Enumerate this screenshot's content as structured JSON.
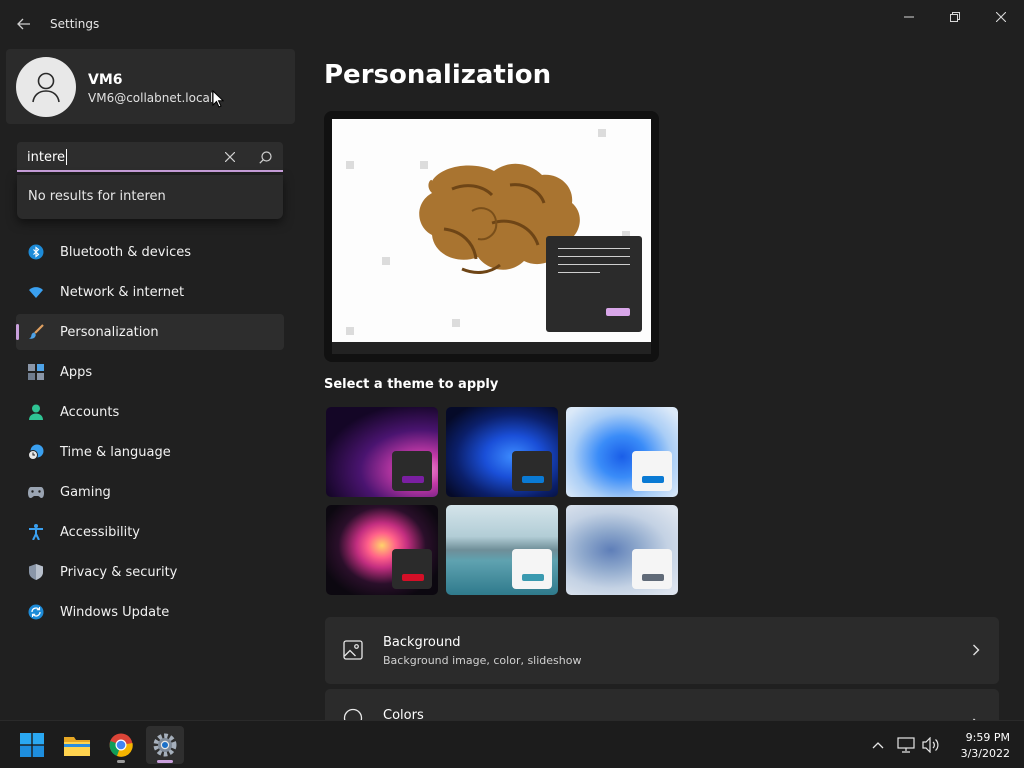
{
  "window": {
    "title": "Settings"
  },
  "profile": {
    "name": "VM6",
    "email": "VM6@collabnet.local"
  },
  "search": {
    "value": "intere",
    "no_results_text": "No results for interen"
  },
  "nav": {
    "items": [
      {
        "label": "Bluetooth & devices",
        "icon": "bluetooth-icon"
      },
      {
        "label": "Network & internet",
        "icon": "wifi-icon"
      },
      {
        "label": "Personalization",
        "icon": "brush-icon",
        "active": true
      },
      {
        "label": "Apps",
        "icon": "apps-icon"
      },
      {
        "label": "Accounts",
        "icon": "person-icon"
      },
      {
        "label": "Time & language",
        "icon": "globe-clock-icon"
      },
      {
        "label": "Gaming",
        "icon": "gamepad-icon"
      },
      {
        "label": "Accessibility",
        "icon": "accessibility-icon"
      },
      {
        "label": "Privacy & security",
        "icon": "shield-icon"
      },
      {
        "label": "Windows Update",
        "icon": "update-icon"
      }
    ]
  },
  "main": {
    "title": "Personalization",
    "themes_label": "Select a theme to apply",
    "themes": [
      {
        "name": "theme-glow",
        "accent": "#7a1fa2"
      },
      {
        "name": "theme-windows-dark",
        "accent": "#0a7ad4"
      },
      {
        "name": "theme-windows-light",
        "accent": "#0a7ad4"
      },
      {
        "name": "theme-captured-motion",
        "accent": "#d40f27"
      },
      {
        "name": "theme-sunrise",
        "accent": "#3a9ab0"
      },
      {
        "name": "theme-flow",
        "accent": "#606a78"
      }
    ],
    "rows": [
      {
        "title": "Background",
        "subtitle": "Background image, color, slideshow",
        "icon": "image-icon"
      },
      {
        "title": "Colors",
        "subtitle": "",
        "icon": "palette-icon"
      }
    ]
  },
  "colors": {
    "accent": "#c9a0dc",
    "background": "#202020",
    "card": "#2b2b2b"
  },
  "taskbar": {
    "apps": [
      "start-icon",
      "file-explorer-icon",
      "chrome-icon",
      "settings-icon"
    ],
    "tray": [
      "chevron-up-icon",
      "network-icon",
      "volume-icon"
    ],
    "time": "9:59 PM",
    "date": "3/3/2022"
  }
}
